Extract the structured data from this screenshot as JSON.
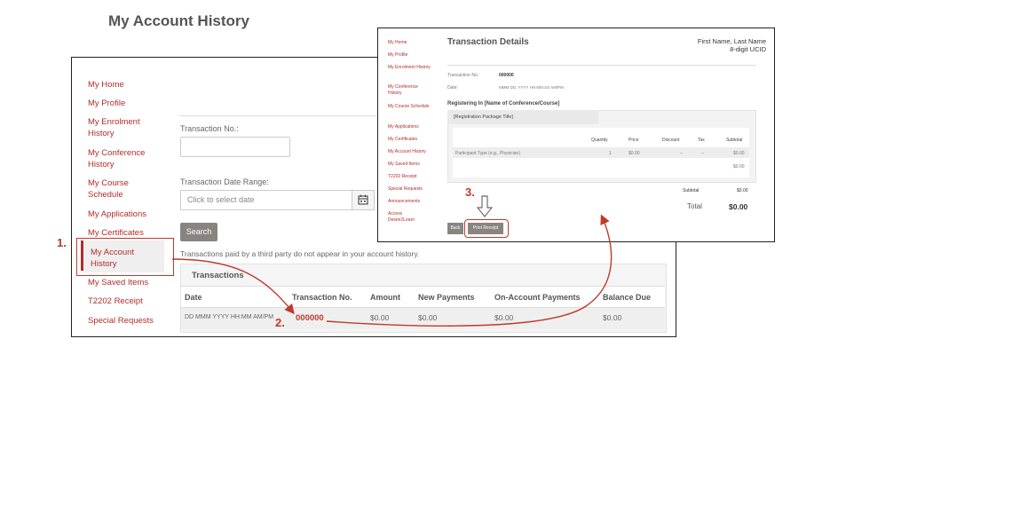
{
  "account_history": {
    "sidebar": [
      {
        "label": "My Home"
      },
      {
        "label": "My Profile"
      },
      {
        "label": "My Enrolment History"
      },
      {
        "label": "My Conference History"
      },
      {
        "label": "My Course Schedule"
      },
      {
        "label": "My Applications"
      },
      {
        "label": "My Certificates"
      },
      {
        "label": "My Account History"
      },
      {
        "label": "My Saved Items"
      },
      {
        "label": "T2202 Receipt"
      },
      {
        "label": "Special Requests"
      }
    ],
    "title": "My Account History",
    "transaction_no_label": "Transaction No.:",
    "date_range_label": "Transaction Date Range:",
    "date_placeholder": "Click to select date",
    "search_label": "Search",
    "note": "Transactions paid by a third party do not appear in your account history.",
    "transactions_heading": "Transactions",
    "columns": [
      "Date",
      "Transaction No.",
      "Amount",
      "New Payments",
      "On-Account Payments",
      "Balance Due"
    ],
    "row": {
      "date": "DD MMM YYYY HH:MM AM/PM",
      "transaction_no": "000000",
      "amount": "$0.00",
      "new_payments": "$0.00",
      "on_account": "$0.00",
      "balance_due": "$0.00"
    }
  },
  "transaction_details": {
    "sidebar": [
      {
        "label": "My Home"
      },
      {
        "label": "My Profile"
      },
      {
        "label": "My Enrolment History"
      },
      {
        "label": "My Conference History"
      },
      {
        "label": "My Course Schedule"
      },
      {
        "label": "My Applications"
      },
      {
        "label": "My Certificates"
      },
      {
        "label": "My Account History"
      },
      {
        "label": "My Saved Items"
      },
      {
        "label": "T2202 Receipt"
      },
      {
        "label": "Special Requests"
      },
      {
        "label": "Announcements"
      },
      {
        "label": "Access Desire2Learn"
      }
    ],
    "title": "Transaction Details",
    "user_name": "First Name, Last Name",
    "user_id": "8-digit UCID",
    "transaction_no_label": "Transaction No.:",
    "transaction_no": "000000",
    "date_label": "Date:",
    "date_value": "MMM DD, YYYY HH:MM:SS AM/PM",
    "registering_in": "Registering In [Name of Conference/Course]",
    "package_title": "[Registration Package Title]",
    "columns": [
      "Quantity",
      "Price",
      "Discount",
      "Tax",
      "Subtotal"
    ],
    "line_item": {
      "description": "Participant Type (e.g., Physician)",
      "quantity": "1",
      "price": "$0.00",
      "discount": "--",
      "tax": "--",
      "subtotal": "$0.00"
    },
    "package_subtotal": "$0.00",
    "subtotal_label": "Subtotal",
    "subtotal_value": "$0.00",
    "total_label": "Total",
    "total_value": "$0.00",
    "back_label": "Back",
    "print_label": "Print Receipt"
  },
  "annotations": {
    "step1": "1.",
    "step2": "2.",
    "step3": "3.",
    "accent_color": "#c0392b"
  }
}
